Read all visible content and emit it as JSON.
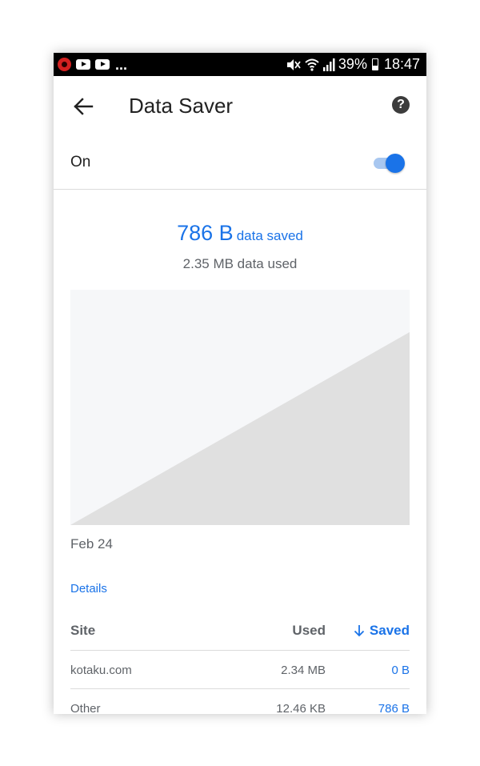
{
  "status_bar": {
    "battery": "39%",
    "time": "18:47",
    "notification_icons": [
      "app-icon",
      "youtube-icon",
      "youtube-icon"
    ],
    "overflow": "...",
    "system_icons": [
      "mute-icon",
      "wifi-icon",
      "signal-icon",
      "battery-icon"
    ]
  },
  "app_bar": {
    "title": "Data Saver"
  },
  "toggle": {
    "label": "On",
    "state": "on",
    "accent_color": "#1a73e8"
  },
  "summary": {
    "saved_amount": "786 B",
    "saved_label": "data saved",
    "used_text": "2.35 MB data used"
  },
  "chart_data": {
    "type": "area",
    "x": [
      "Feb 24",
      ""
    ],
    "series": [
      {
        "values": [
          0,
          0.82
        ]
      }
    ],
    "xlabel": "",
    "ylabel": "",
    "date_label": "Feb 24"
  },
  "details": {
    "link_label": "Details"
  },
  "table": {
    "columns": {
      "site": "Site",
      "used": "Used",
      "saved": "Saved"
    },
    "sort_indicator": "arrow-down-icon",
    "rows": [
      {
        "site": "kotaku.com",
        "used": "2.34 MB",
        "saved": "0 B"
      },
      {
        "site": "Other",
        "used": "12.46 KB",
        "saved": "786 B"
      }
    ]
  }
}
